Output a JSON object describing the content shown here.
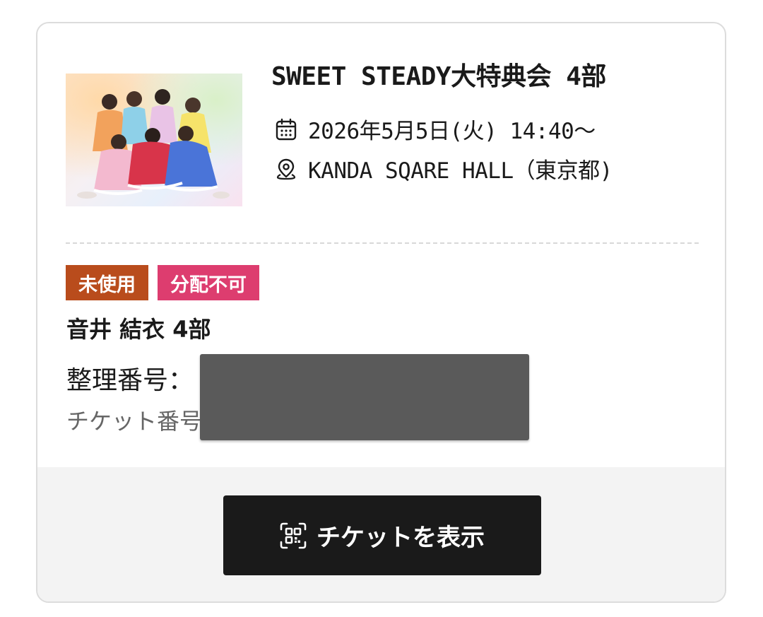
{
  "event": {
    "title": "SWEET STEADY大特典会 4部",
    "date": "2026年5月5日(火) 14:40〜",
    "venue": "KANDA SQARE HALL（東京都)",
    "image_alt": "SWEET STEADY group photo",
    "date_icon": "calendar-icon",
    "venue_icon": "map-pin-icon"
  },
  "badges": {
    "unused": "未使用",
    "not_distributable": "分配不可"
  },
  "ticket": {
    "member": "音井 結衣 4部",
    "seat_label": "整理番号：",
    "ticket_number_label": "チケット番号"
  },
  "footer": {
    "show_ticket_label": "チケットを表示",
    "show_ticket_icon": "qr-code-icon"
  },
  "colors": {
    "badge_unused": "#b94c1c",
    "badge_not_distributable": "#dd3d6f",
    "button_bg": "#1a1a1a"
  }
}
